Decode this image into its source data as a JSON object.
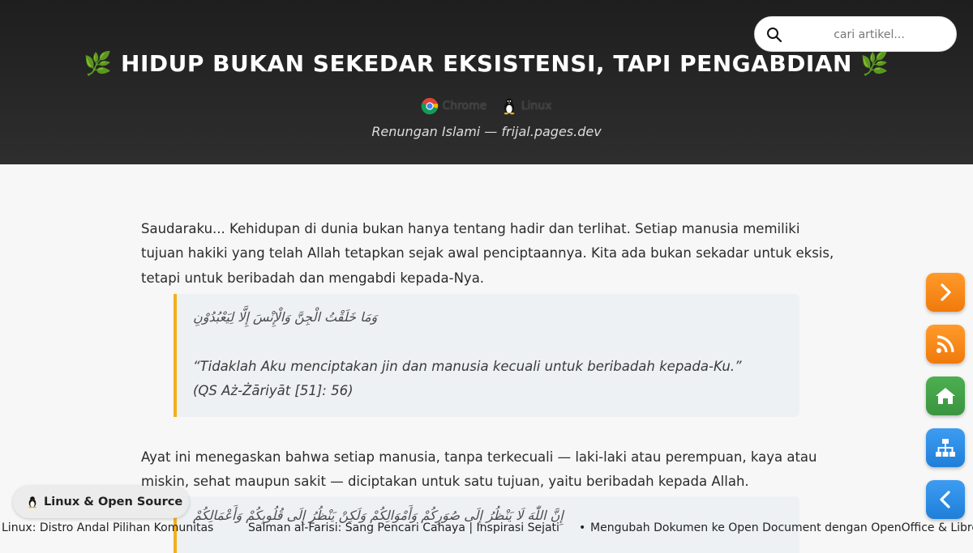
{
  "header": {
    "title": "HIDUP BUKAN SEKEDAR EKSISTENSI, TAPI PENGABDIAN",
    "title_icon": "leaf-icon",
    "badges": [
      {
        "label": "Chrome",
        "icon": "chrome-icon"
      },
      {
        "label": "Linux",
        "icon": "tux-icon"
      }
    ],
    "subtitle": "Renungan Islami — frijal.pages.dev"
  },
  "search": {
    "placeholder": "cari artikel...",
    "value": ""
  },
  "article": {
    "paragraph1": "Saudaraku... Kehidupan di dunia bukan hanya tentang hadir dan terlihat. Setiap manusia memiliki tujuan hakiki yang telah Allah tetapkan sejak awal penciptaannya. Kita ada bukan sekadar untuk eksis, tetapi untuk beribadah dan mengabdi kepada-Nya.",
    "quote1": {
      "arabic": "وَمَا خَلَقْتُ الْجِنَّ وَالْإِنْسَ إِلَّا لِيَعْبُدُوْنِ",
      "translation": "“Tidaklah Aku menciptakan jin dan manusia kecuali untuk beribadah kepada-Ku.”",
      "reference": "(QS Aż-Żāriyāt [51]: 56)"
    },
    "paragraph2": "Ayat ini menegaskan bahwa setiap manusia, tanpa terkecuali — laki-laki atau perempuan, kaya atau miskin, sehat maupun sakit — diciptakan untuk satu tujuan, yaitu beribadah kepada Allah.",
    "quote2": {
      "arabic": "إِنَّ اللّٰهَ لَا يَنْظُرُ إِلَى صُوَرِكُمْ وَأَمْوَالِكُمْ وَلَكِنْ يَنْظُرُ إِلَى قُلُوبِكُمْ وَأَعْمَالِكُمْ"
    }
  },
  "side_buttons": [
    {
      "name": "next-button",
      "icon": "chevron-right-icon",
      "color": "#f5891a"
    },
    {
      "name": "rss-button",
      "icon": "rss-icon",
      "color": "#f5891a"
    },
    {
      "name": "home-button",
      "icon": "home-icon",
      "color": "#45a348"
    },
    {
      "name": "sitemap-button",
      "icon": "sitemap-icon",
      "color": "#2f8ee6"
    },
    {
      "name": "back-button",
      "icon": "chevron-left-icon",
      "color": "#2f8ee6"
    }
  ],
  "category_pill": {
    "icon": "tux-icon",
    "label": "Linux & Open Source"
  },
  "ticker": {
    "items": [
      "Linux: Distro Andal Pilihan Komunitas",
      "Salman al-Farisi: Sang Pencari Cahaya | Inspirasi Sejati",
      "•",
      "Mengubah Dokumen ke Open Document dengan OpenOffice & LibreOffice"
    ]
  }
}
